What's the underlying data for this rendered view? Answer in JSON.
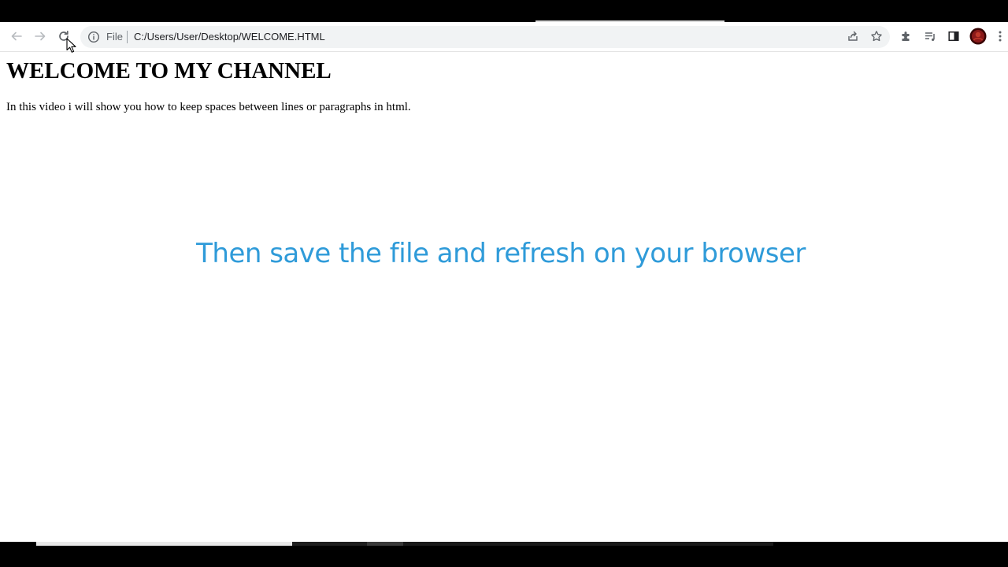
{
  "browser": {
    "toolbar": {
      "back_icon": "arrow-left-icon",
      "forward_icon": "arrow-right-icon",
      "reload_icon": "reload-icon",
      "share_icon": "share-icon",
      "bookmark_icon": "star-icon",
      "extensions_icon": "puzzle-icon",
      "reading_list_icon": "reading-list-icon",
      "side_panel_icon": "side-panel-icon",
      "profile_icon": "avatar-icon",
      "menu_icon": "kebab-menu-icon"
    },
    "omnibox": {
      "site_info_icon": "info-icon",
      "scheme_label": "File",
      "url": "C:/Users/User/Desktop/WELCOME.HTML"
    }
  },
  "page": {
    "heading": "WELCOME TO MY CHANNEL",
    "paragraph": "In this video i will show you how to keep spaces between lines or paragraphs in html."
  },
  "overlay": {
    "caption": "Then save the file and refresh on your browser",
    "caption_color": "#2f9bd9"
  },
  "colors": {
    "toolbar_bg": "#ffffff",
    "omnibox_bg": "#f1f3f4",
    "icon_color": "#5f6368",
    "avatar_color": "#8b1a1a"
  }
}
